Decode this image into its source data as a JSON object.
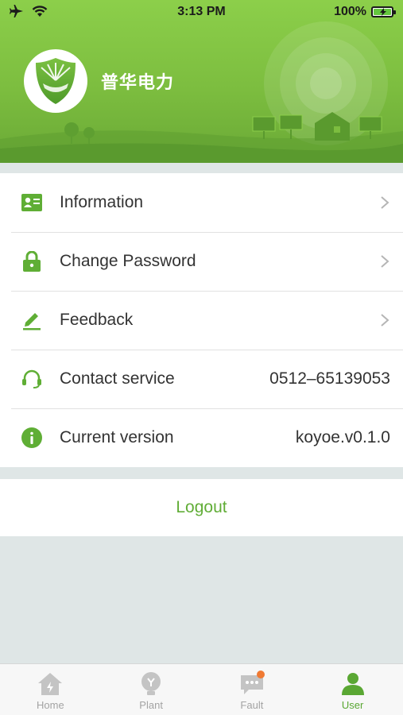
{
  "status_bar": {
    "time": "3:13 PM",
    "battery": "100%"
  },
  "profile": {
    "app_name": "普华电力"
  },
  "menu": [
    {
      "label": "Information",
      "value": "",
      "icon": "id-card-icon",
      "chevron": true
    },
    {
      "label": "Change Password",
      "value": "",
      "icon": "lock-icon",
      "chevron": true
    },
    {
      "label": "Feedback",
      "value": "",
      "icon": "pencil-icon",
      "chevron": true
    },
    {
      "label": "Contact service",
      "value": "0512–65139053",
      "icon": "headset-icon",
      "chevron": false
    },
    {
      "label": "Current version",
      "value": "koyoe.v0.1.0",
      "icon": "info-icon",
      "chevron": false
    }
  ],
  "logout_label": "Logout",
  "tabs": [
    {
      "label": "Home",
      "icon": "home-icon",
      "active": false
    },
    {
      "label": "Plant",
      "icon": "plant-icon",
      "active": false
    },
    {
      "label": "Fault",
      "icon": "fault-icon",
      "active": false,
      "badge": true
    },
    {
      "label": "User",
      "icon": "user-icon",
      "active": true
    }
  ],
  "colors": {
    "accent": "#61ad37",
    "header_green": "#7cbd3f",
    "badge": "#f07a33",
    "background": "#dfe6e6"
  }
}
